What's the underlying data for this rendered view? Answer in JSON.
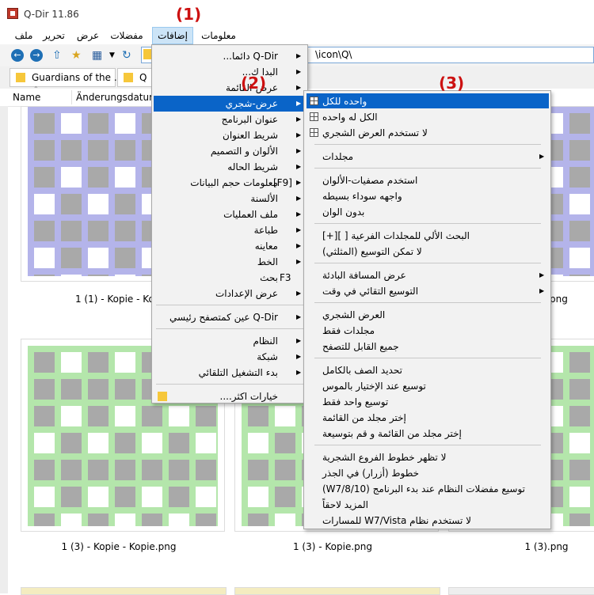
{
  "window": {
    "title": "Q-Dir 11.86"
  },
  "menubar": [
    "ملف",
    "تحرير",
    "عرض",
    "مفضلات",
    "إضافات",
    "معلومات"
  ],
  "path": {
    "value": "\\icon\\Q\\"
  },
  "tabs": [
    {
      "label": "Guardians of the ..."
    },
    {
      "label": "Q"
    }
  ],
  "columns": {
    "name": "Name",
    "date": "Änderungsdatum"
  },
  "files": [
    {
      "caption": "1 (1) - Kopie - Kopie.",
      "color": "#b4b4ea"
    },
    {
      "caption": "1 (3) - Kopie - Kopie.png",
      "color": "#b4e6ab"
    },
    {
      "caption": "1 (3) - Kopie.png",
      "color": "#b4e6ab"
    },
    {
      "caption": "1 (3).png",
      "color": "#b4e6ab"
    },
    {
      "caption": "png",
      "color": "#b4b4ea"
    }
  ],
  "annotations": [
    "(1)",
    "(2)",
    "(3)"
  ],
  "addons_menu": [
    {
      "label": "Q-Dir دائما...",
      "arrow": true
    },
    {
      "label": "البدا ك...",
      "arrow": true
    },
    {
      "label": "عرض-القائمة",
      "arrow": true
    },
    {
      "label": "عرض-شجري",
      "arrow": true,
      "active": true
    },
    {
      "label": "عنوان البرنامج",
      "arrow": true
    },
    {
      "label": "شريط العنوان",
      "arrow": true
    },
    {
      "label": "الألوان و التصميم",
      "arrow": true
    },
    {
      "label": "شريط الحاله",
      "arrow": true
    },
    {
      "label": "معلومات حجم البيانات",
      "arrow": true,
      "shortcut": "[F9]"
    },
    {
      "label": "الألسنة",
      "arrow": true
    },
    {
      "label": "ملف العمليات",
      "arrow": true
    },
    {
      "label": "طباعة",
      "arrow": true
    },
    {
      "label": "معاينه",
      "arrow": true
    },
    {
      "label": "الخط",
      "arrow": true
    },
    {
      "label": "بحث",
      "arrow": false,
      "shortcut": "F3"
    },
    {
      "label": "عرض الإعدادات",
      "arrow": true
    },
    {
      "sep": true
    },
    {
      "label": "Q-Dir عين كمتصفح رئيسي",
      "arrow": true
    },
    {
      "sep": true
    },
    {
      "label": "النظام",
      "arrow": true
    },
    {
      "label": "شبكة",
      "arrow": true
    },
    {
      "label": "بدء التشغيل التلقائي",
      "arrow": true
    },
    {
      "sep": true
    },
    {
      "label": "خيارات اكثر....",
      "arrow": false,
      "folder": true
    }
  ],
  "tree_menu": [
    {
      "label": "واحده للكل",
      "icon": "grid-icon",
      "active": true
    },
    {
      "label": "الكل له واحده",
      "icon": "grid-icon"
    },
    {
      "label": "لا تستخدم العرض الشجري",
      "icon": "grid-icon"
    },
    {
      "sep": true
    },
    {
      "label": "مجلدات",
      "arrow": true
    },
    {
      "sep": true
    },
    {
      "label": "استخدم مصفيات-الألوان"
    },
    {
      "label": "واجهه سوداء بسيطه"
    },
    {
      "label": "بدون الوان"
    },
    {
      "sep": true
    },
    {
      "label": "البحث الألي للمجلدات الفرعية [ ][+]"
    },
    {
      "label": "لا تمكن التوسيع (المثلثي)"
    },
    {
      "sep": true
    },
    {
      "label": "عرض المسافة البادئة",
      "arrow": true
    },
    {
      "label": "التوسيع التقائي في وقت",
      "arrow": true
    },
    {
      "sep": true
    },
    {
      "label": "العرض الشجري"
    },
    {
      "label": "مجلدات فقط"
    },
    {
      "label": "جميع القابل للتصفح"
    },
    {
      "sep": true
    },
    {
      "label": "تحديد الصف بالكامل"
    },
    {
      "label": "توسيع عند الإختيار بالموس"
    },
    {
      "label": "توسيع واحد فقط"
    },
    {
      "label": "إختر مجلد من القائمة"
    },
    {
      "label": "إختر مجلد من القائمة و قم بتوسيعة"
    },
    {
      "sep": true
    },
    {
      "label": "لا تظهر خطوط الفروع الشجرية"
    },
    {
      "label": "خطوط (أزرار) في الجذر"
    },
    {
      "label": "(W7/8/10) توسيع مفضلات النظام عند بدء البرنامج"
    },
    {
      "label": "المزيد لاحقاً"
    },
    {
      "label": "لا تستخدم نظام W7/Vista للمسارات"
    }
  ],
  "colors": {
    "highlight": "#0a64c8",
    "annotation": "#cc1111"
  }
}
